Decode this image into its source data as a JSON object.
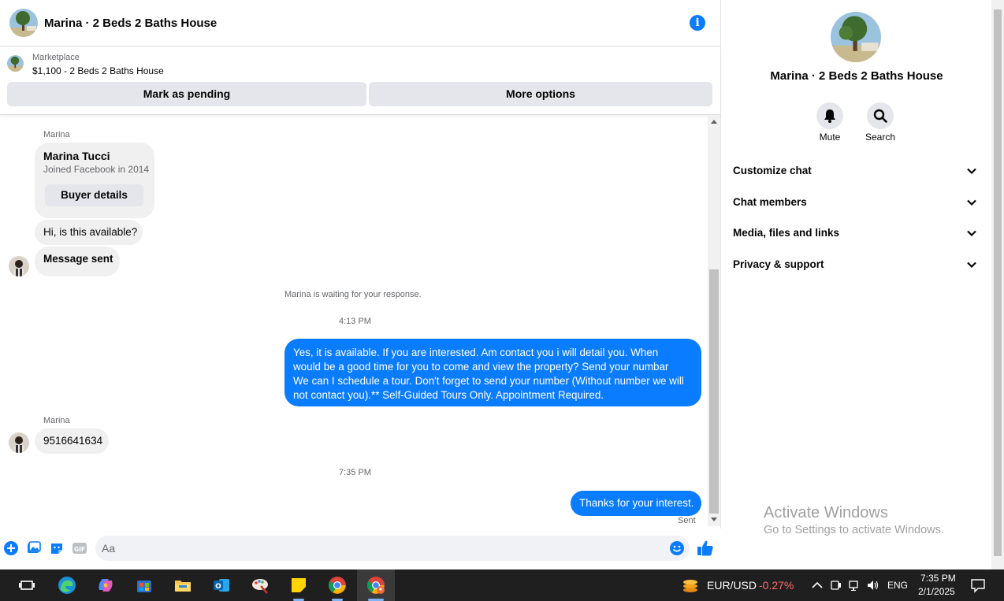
{
  "header": {
    "title": "Marina · 2 Beds 2 Baths House"
  },
  "marketplace": {
    "label": "Marketplace",
    "listing": "$1,100 - 2 Beds 2 Baths House",
    "mark_pending": "Mark as pending",
    "more_options": "More options"
  },
  "messages": {
    "sender_1": "Marina",
    "buyer_name": "Marina Tucci",
    "buyer_joined": "Joined Facebook in 2014",
    "buyer_details": "Buyer details",
    "msg_available": "Hi, is this available?",
    "msg_sent": "Message sent",
    "waiting": "Marina is waiting for your response.",
    "time_1": "4:13 PM",
    "reply_1": "Yes, it is available. If you are interested.  Am contact you i will detail you.  When would be a good time for you to come and view the property? Send your numbar We can I schedule a tour.  Don't forget to send your number (Without number we will not contact you).** Self-Guided Tours Only. Appointment Required.",
    "sender_2": "Marina",
    "phone": "9516641634",
    "time_2": "7:35 PM",
    "reply_2": "Thanks for your interest.",
    "status": "Sent"
  },
  "composer": {
    "placeholder": "Aa"
  },
  "info": {
    "title": "Marina · 2 Beds 2 Baths House",
    "mute": "Mute",
    "search": "Search",
    "sections": [
      "Customize chat",
      "Chat members",
      "Media, files and links",
      "Privacy & support"
    ]
  },
  "watermark": {
    "line1": "Activate Windows",
    "line2": "Go to Settings to activate Windows."
  },
  "taskbar": {
    "ticker": "EUR/USD",
    "change": "-0.27%",
    "lang": "ENG",
    "time": "7:35 PM",
    "date": "2/1/2025"
  },
  "colors": {
    "accent": "#0a7cff",
    "negative": "#ff6b6b"
  }
}
